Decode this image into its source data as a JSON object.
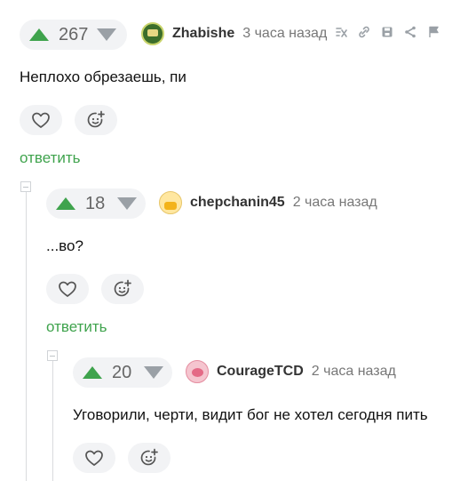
{
  "comments": [
    {
      "votes": "267",
      "username": "Zhabishe",
      "time": "3 часа назад",
      "text": "Неплохо обрезаешь, пи",
      "reply_label": "ответить",
      "icons": [
        "bookmark-slash-icon",
        "link-icon",
        "save-icon",
        "share-icon",
        "flag-icon"
      ]
    },
    {
      "votes": "18",
      "username": "chepchanin45",
      "time": "2 часа назад",
      "text": "...во?",
      "reply_label": "ответить"
    },
    {
      "votes": "20",
      "username": "CourageTCD",
      "time": "2 часа назад",
      "text": "Уговорили, черти, видит бог не хотел сегодня пить"
    }
  ],
  "colors": {
    "upvote": "#3fa34d",
    "downvote": "#9aa0a6",
    "reply": "#3fa34d",
    "pill_bg": "#f2f3f5"
  }
}
